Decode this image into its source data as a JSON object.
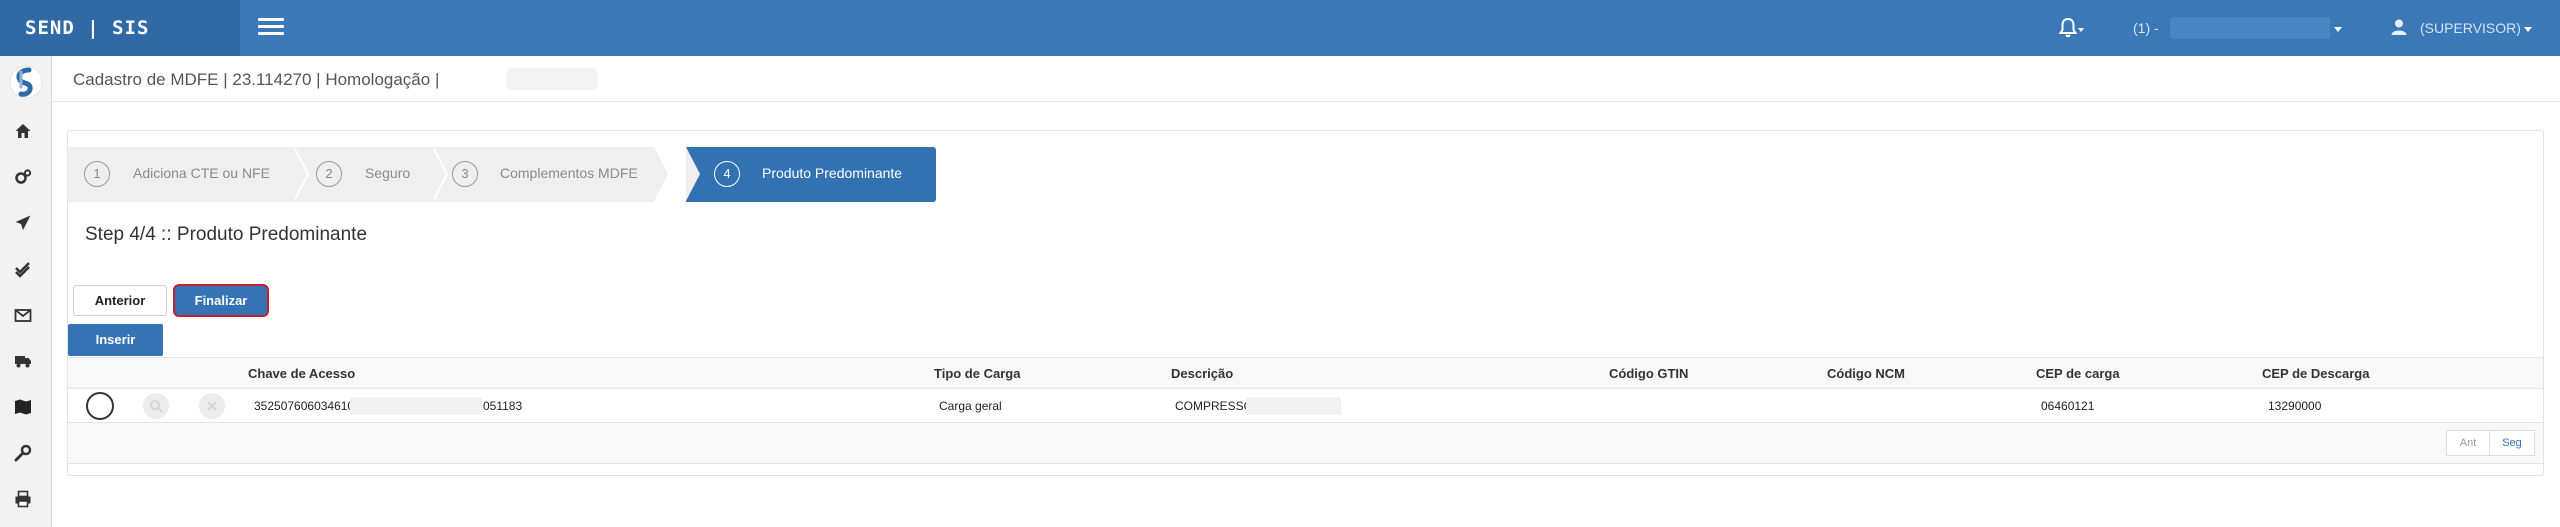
{
  "brand": "SEND | SIS",
  "header": {
    "company_label": "(1) -",
    "user_label": "(SUPERVISOR)"
  },
  "icons": {
    "menu": "hamburger-icon",
    "notifications": "bell-icon",
    "user": "user-icon"
  },
  "sidebar": {
    "items": [
      {
        "name": "home",
        "icon": "home-icon"
      },
      {
        "name": "settings",
        "icon": "gears-icon"
      },
      {
        "name": "send",
        "icon": "paper-plane-icon"
      },
      {
        "name": "approvals",
        "icon": "double-check-icon"
      },
      {
        "name": "mail",
        "icon": "envelope-icon"
      },
      {
        "name": "transport",
        "icon": "truck-icon"
      },
      {
        "name": "map",
        "icon": "map-icon"
      },
      {
        "name": "tools",
        "icon": "wrench-icon"
      },
      {
        "name": "print",
        "icon": "print-icon"
      }
    ]
  },
  "page": {
    "title": "Cadastro de MDFE | 23.114270 | Homologação |"
  },
  "wizard": {
    "steps": [
      {
        "num": "1",
        "label": "Adiciona CTE ou NFE"
      },
      {
        "num": "2",
        "label": "Seguro"
      },
      {
        "num": "3",
        "label": "Complementos MDFE"
      },
      {
        "num": "4",
        "label": "Produto Predominante"
      }
    ],
    "active_step": 4,
    "heading": "Step 4/4 :: Produto Predominante"
  },
  "buttons": {
    "anterior": "Anterior",
    "finalizar": "Finalizar",
    "inserir": "Inserir"
  },
  "table": {
    "columns": [
      "Chave de Acesso",
      "Tipo de Carga",
      "Descrição",
      "Código GTIN",
      "Código NCM",
      "CEP de carga",
      "CEP de Descarga"
    ],
    "rows": [
      {
        "chave_start": "352507606034610O",
        "chave_end": "051183",
        "tipo": "Carga geral",
        "descricao": "COMPRESSOF",
        "gtin": "",
        "ncm": "",
        "cep_carga": "06460121",
        "cep_descarga": "13290000"
      }
    ],
    "pager": {
      "prev": "Ant",
      "next": "Seg"
    }
  },
  "colors": {
    "navbar": "#3a78b8",
    "brand_bg": "#2f69a6",
    "primary": "#3573b4",
    "finalizar_border": "#c0202f"
  }
}
